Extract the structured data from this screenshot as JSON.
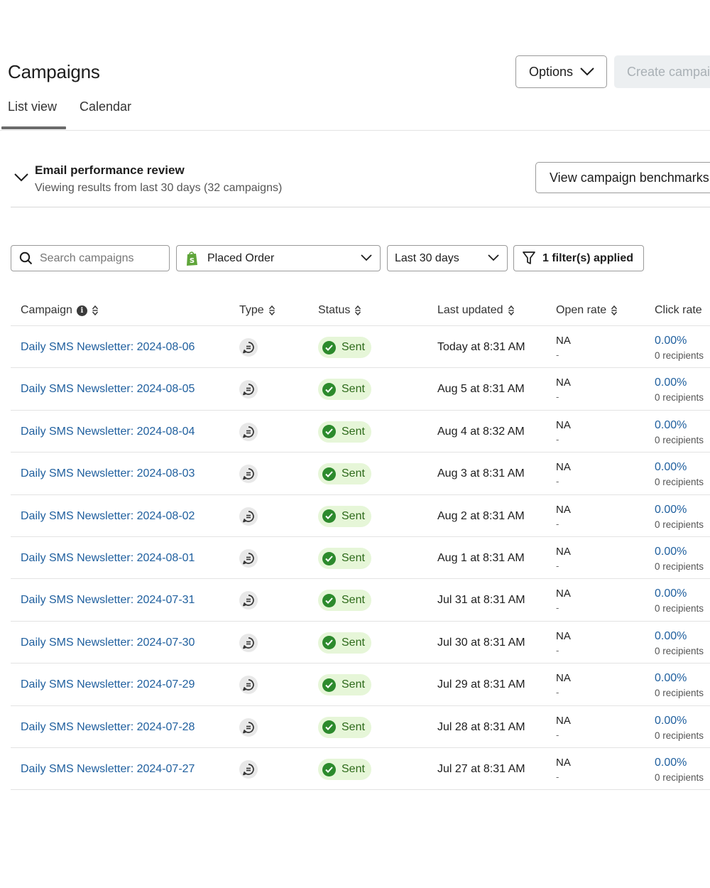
{
  "header": {
    "title": "Campaigns",
    "options_label": "Options",
    "create_label": "Create campaign"
  },
  "tabs": [
    {
      "label": "List view",
      "active": true
    },
    {
      "label": "Calendar",
      "active": false
    }
  ],
  "performance": {
    "title": "Email performance review",
    "subtitle": "Viewing results from last 30 days (32 campaigns)",
    "benchmarks_label": "View campaign benchmarks"
  },
  "filters": {
    "search_placeholder": "Search campaigns",
    "event_value": "Placed Order",
    "date_value": "Last 30 days",
    "filter_label": "1 filter(s) applied"
  },
  "table": {
    "columns": {
      "campaign": "Campaign",
      "type": "Type",
      "status": "Status",
      "last_updated": "Last updated",
      "open_rate": "Open rate",
      "click_rate": "Click rate"
    },
    "rows": [
      {
        "name": "Daily SMS Newsletter: 2024-08-06",
        "status": "Sent",
        "updated": "Today at 8:31 AM",
        "open": "NA",
        "open_sub": "-",
        "click": "0.00%",
        "click_sub": "0 recipients"
      },
      {
        "name": "Daily SMS Newsletter: 2024-08-05",
        "status": "Sent",
        "updated": "Aug 5 at 8:31 AM",
        "open": "NA",
        "open_sub": "-",
        "click": "0.00%",
        "click_sub": "0 recipients"
      },
      {
        "name": "Daily SMS Newsletter: 2024-08-04",
        "status": "Sent",
        "updated": "Aug 4 at 8:32 AM",
        "open": "NA",
        "open_sub": "-",
        "click": "0.00%",
        "click_sub": "0 recipients"
      },
      {
        "name": "Daily SMS Newsletter: 2024-08-03",
        "status": "Sent",
        "updated": "Aug 3 at 8:31 AM",
        "open": "NA",
        "open_sub": "-",
        "click": "0.00%",
        "click_sub": "0 recipients"
      },
      {
        "name": "Daily SMS Newsletter: 2024-08-02",
        "status": "Sent",
        "updated": "Aug 2 at 8:31 AM",
        "open": "NA",
        "open_sub": "-",
        "click": "0.00%",
        "click_sub": "0 recipients"
      },
      {
        "name": "Daily SMS Newsletter: 2024-08-01",
        "status": "Sent",
        "updated": "Aug 1 at 8:31 AM",
        "open": "NA",
        "open_sub": "-",
        "click": "0.00%",
        "click_sub": "0 recipients"
      },
      {
        "name": "Daily SMS Newsletter: 2024-07-31",
        "status": "Sent",
        "updated": "Jul 31 at 8:31 AM",
        "open": "NA",
        "open_sub": "-",
        "click": "0.00%",
        "click_sub": "0 recipients"
      },
      {
        "name": "Daily SMS Newsletter: 2024-07-30",
        "status": "Sent",
        "updated": "Jul 30 at 8:31 AM",
        "open": "NA",
        "open_sub": "-",
        "click": "0.00%",
        "click_sub": "0 recipients"
      },
      {
        "name": "Daily SMS Newsletter: 2024-07-29",
        "status": "Sent",
        "updated": "Jul 29 at 8:31 AM",
        "open": "NA",
        "open_sub": "-",
        "click": "0.00%",
        "click_sub": "0 recipients"
      },
      {
        "name": "Daily SMS Newsletter: 2024-07-28",
        "status": "Sent",
        "updated": "Jul 28 at 8:31 AM",
        "open": "NA",
        "open_sub": "-",
        "click": "0.00%",
        "click_sub": "0 recipients"
      },
      {
        "name": "Daily SMS Newsletter: 2024-07-27",
        "status": "Sent",
        "updated": "Jul 27 at 8:31 AM",
        "open": "NA",
        "open_sub": "-",
        "click": "0.00%",
        "click_sub": "0 recipients"
      }
    ]
  }
}
